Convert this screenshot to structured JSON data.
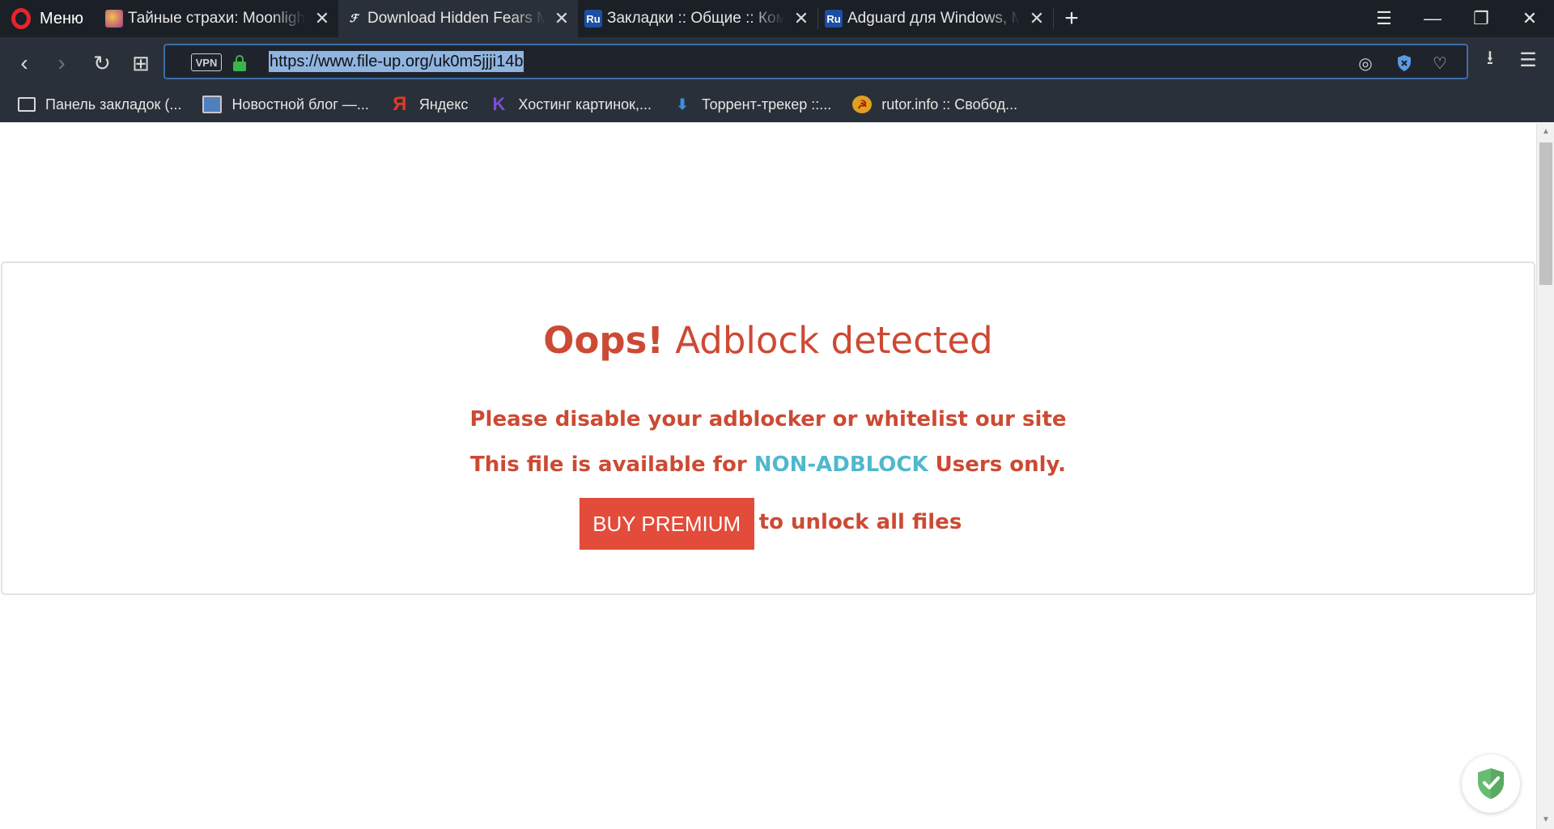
{
  "browser": {
    "menu_label": "Меню",
    "tabs": [
      {
        "title": "Тайные страхи: Moonlight",
        "favicon": "game-favicon"
      },
      {
        "title": "Download Hidden Fears Mo",
        "favicon": "file-up-favicon",
        "active": true
      },
      {
        "title": "Закладки :: Общие :: Комп",
        "favicon": "ru-favicon",
        "favicon_text": "Ru"
      },
      {
        "title": "Adguard для Windows, Ma",
        "favicon": "ru-favicon",
        "favicon_text": "Ru"
      }
    ],
    "close_glyph": "✕",
    "new_tab_glyph": "+",
    "window_controls": {
      "easy_setup": "☰",
      "minimize": "—",
      "restore": "❐",
      "close": "✕"
    }
  },
  "navbar": {
    "back_glyph": "‹",
    "forward_glyph": "›",
    "reload_glyph": "↻",
    "tabs_glyph": "⊞",
    "vpn_label": "VPN",
    "url": "https://www.file-up.org/uk0m5jjji14b",
    "snapshot_glyph": "◎",
    "adblock_glyph": "✕",
    "favorite_glyph": "♡",
    "download_glyph": "⭳",
    "settings_glyph": "☰"
  },
  "bookmarks": [
    {
      "label": "Панель закладок (...",
      "icon": "folder-icon"
    },
    {
      "label": "Новостной блог —...",
      "icon": "monitor-icon"
    },
    {
      "label": "Яндекс",
      "icon": "yandex-icon",
      "glyph": "Я"
    },
    {
      "label": "Хостинг картинок,...",
      "icon": "k-icon",
      "glyph": "K"
    },
    {
      "label": "Торрент-трекер ::...",
      "icon": "torrent-icon",
      "glyph": "⬇"
    },
    {
      "label": "rutor.info :: Свобод...",
      "icon": "rutor-icon",
      "glyph": "☭"
    }
  ],
  "page": {
    "title_bold": "Oops!",
    "title_rest": " Adblock detected",
    "line1": "Please disable your adblocker or whitelist our site",
    "line2_prefix": "This file is available for ",
    "line2_highlight": "NON-ADBLOCK",
    "line2_suffix": " Users only.",
    "buy_button": "BUY PREMIUM",
    "unlock_text": "to unlock all files",
    "colors": {
      "accent_red": "#cc4a34",
      "button_red": "#e34b3a",
      "highlight_cyan": "#4fb8cc"
    }
  }
}
